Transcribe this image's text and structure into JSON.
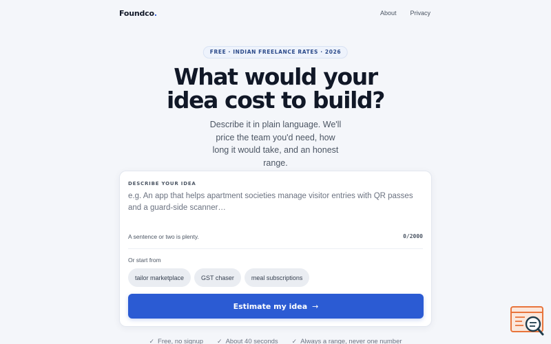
{
  "nav": {
    "logo": "Foundco",
    "logo_dot": ".",
    "links": [
      "About",
      "Privacy"
    ]
  },
  "hero": {
    "pill": "FREE · INDIAN FREELANCE RATES · 2026",
    "title_line1": "What would your",
    "title_line2": "idea cost to build?",
    "subtitle": "Describe it in plain language. We'll price the team you'd need, how long it would take, and an honest range."
  },
  "form": {
    "label": "DESCRIBE YOUR IDEA",
    "value": "",
    "placeholder": "e.g. An app that helps apartment societies manage visitor entries with QR passes and a guard-side scanner…",
    "hint": "A sentence or two is plenty.",
    "counter": "0/2000",
    "start_from_label": "Or start from",
    "chips": [
      "tailor marketplace",
      "GST chaser",
      "meal subscriptions"
    ],
    "cta_label": "Estimate my idea",
    "cta_arrow": "→"
  },
  "trust": [
    {
      "check": "✓",
      "text": "Free, no signup"
    },
    {
      "check": "✓",
      "text": "About 40 seconds"
    },
    {
      "check": "✓",
      "text": "Always a range, never one number"
    }
  ],
  "colors": {
    "accent": "#2b5bd3",
    "background": "#f4f6fa",
    "widget_accent": "#e8743b",
    "widget_ink": "#1f3d4d"
  },
  "icons": {
    "cta": "arrow-right-icon",
    "trust": "check-icon",
    "widget": "feedback-search-icon"
  }
}
